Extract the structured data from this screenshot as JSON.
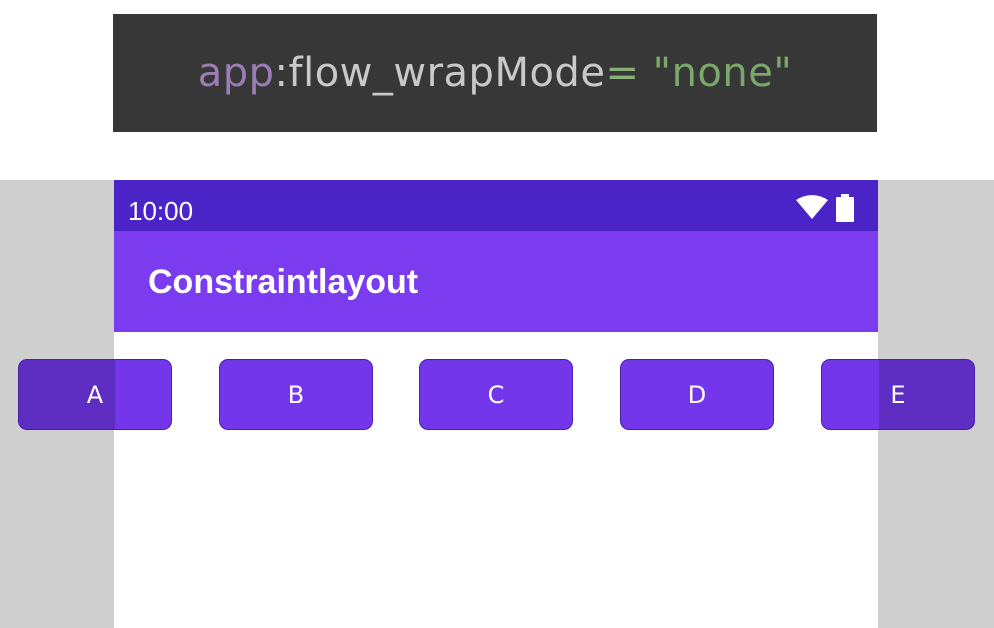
{
  "code_banner": {
    "namespace": "app",
    "separator": ":",
    "attribute": "flow_wrapMode",
    "equals": "=",
    "value": "\"none\""
  },
  "status_bar": {
    "time": "10:00",
    "icons": [
      "wifi-icon",
      "battery-icon"
    ]
  },
  "app_bar": {
    "title": "Constraintlayout"
  },
  "flow_buttons": [
    {
      "label": "A"
    },
    {
      "label": "B"
    },
    {
      "label": "C"
    },
    {
      "label": "D"
    },
    {
      "label": "E"
    }
  ],
  "colors": {
    "code_background": "#373737",
    "status_bar": "#4a24c6",
    "app_bar": "#7b3cf0",
    "button": "#7436ea",
    "outside_region": "#cfcfcf"
  }
}
